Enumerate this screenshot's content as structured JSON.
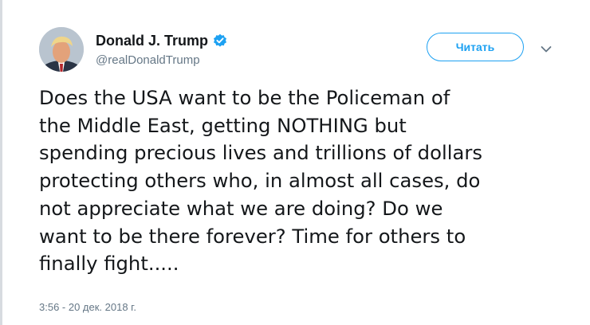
{
  "author": {
    "name": "Donald J. Trump",
    "handle": "@realDonaldTrump",
    "verified": true
  },
  "actions": {
    "follow_label": "Читать"
  },
  "tweet": {
    "lines": [
      "Does the USA want to be the Policeman of",
      "the Middle East, getting NOTHING but",
      "spending precious lives and trillions of dollars",
      "protecting others who, in almost all cases, do",
      "not appreciate what we are doing? Do we",
      "want to be there forever? Time for others to",
      "finally fight....."
    ],
    "timestamp": "3:56 - 20 дек. 2018 г."
  },
  "colors": {
    "accent": "#1da1f2",
    "text": "#14171a",
    "secondary": "#657786"
  },
  "icons": {
    "verified": "verified-badge-icon",
    "menu": "chevron-down-icon"
  }
}
